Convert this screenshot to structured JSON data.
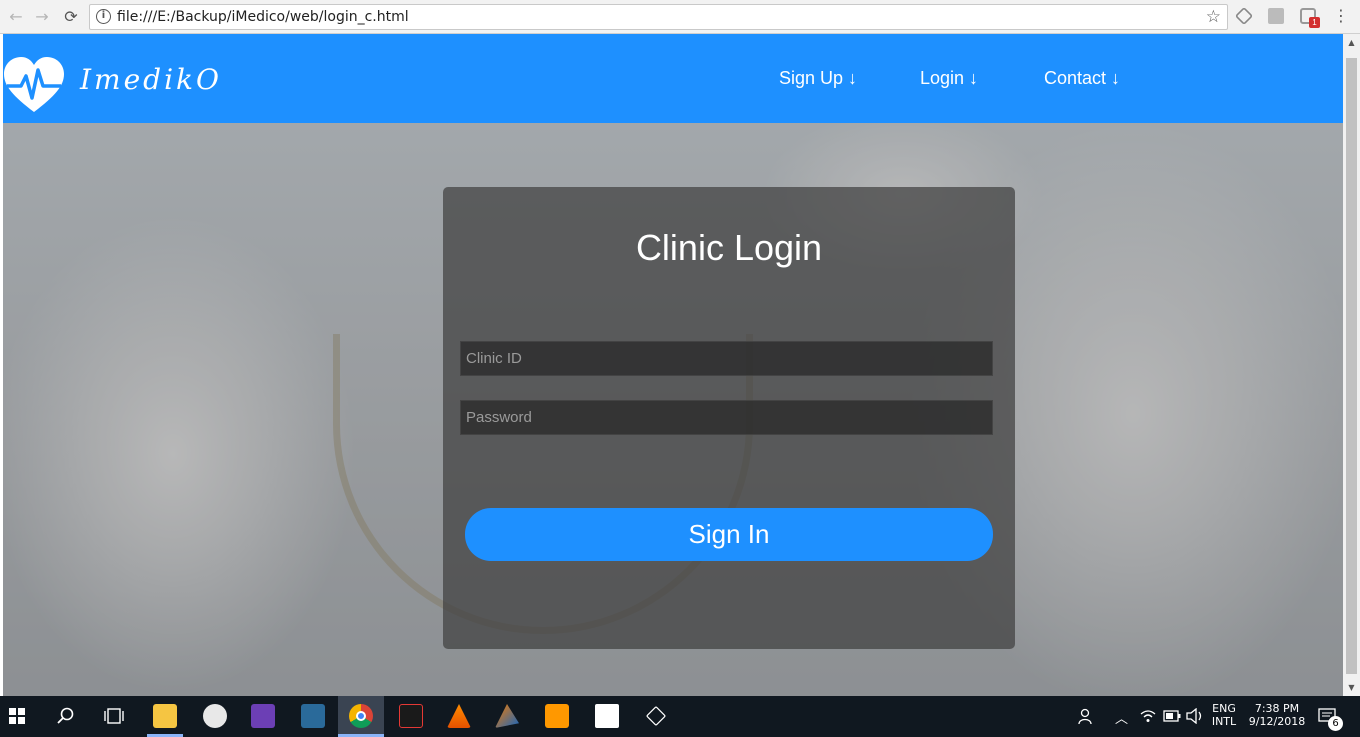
{
  "browser": {
    "url": "file:///E:/Backup/iMedico/web/login_c.html",
    "back_icon": "←",
    "forward_icon": "→",
    "reload_icon": "⟳",
    "star_icon": "☆",
    "ext_badge": "1",
    "menu_icon": "⋮"
  },
  "site": {
    "brand": "ImedikO",
    "nav": {
      "signup": "Sign Up ↓",
      "login": "Login ↓",
      "contact": "Contact ↓"
    },
    "primary_color": "#1e90ff"
  },
  "login": {
    "title": "Clinic Login",
    "clinic_id_placeholder": "Clinic ID",
    "password_placeholder": "Password",
    "signin_label": "Sign In"
  },
  "taskbar": {
    "lang_top": "ENG",
    "lang_bottom": "INTL",
    "time": "7:38 PM",
    "date": "9/12/2018",
    "notifications": "6",
    "apps": [
      "file-explorer",
      "paint",
      "visual-studio",
      "mysql-workbench",
      "chrome",
      "acrobat",
      "vlc",
      "matlab",
      "sublime-text",
      "sticky-notes",
      "unity"
    ]
  }
}
